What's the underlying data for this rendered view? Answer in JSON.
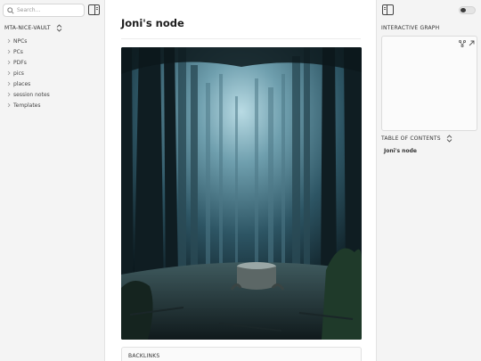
{
  "left_sidebar": {
    "search_placeholder": "Search...",
    "vault_name": "MTA-NICE-VAULT",
    "folders": [
      "NPCs",
      "PCs",
      "PDFs",
      "pics",
      "places",
      "session notes",
      "Templates"
    ]
  },
  "note": {
    "title": "Joni's node",
    "image_alt": "Misty forest with a tree stump",
    "backlinks_label": "BACKLINKS"
  },
  "right_sidebar": {
    "graph_title": "INTERACTIVE GRAPH",
    "toc_title": "TABLE OF CONTENTS",
    "toc_items": [
      "Joni's node"
    ]
  },
  "colors": {
    "accent_dark": "#1c1c1c",
    "forest_light": "#8fb7c4",
    "forest_dark": "#0d1b20"
  }
}
